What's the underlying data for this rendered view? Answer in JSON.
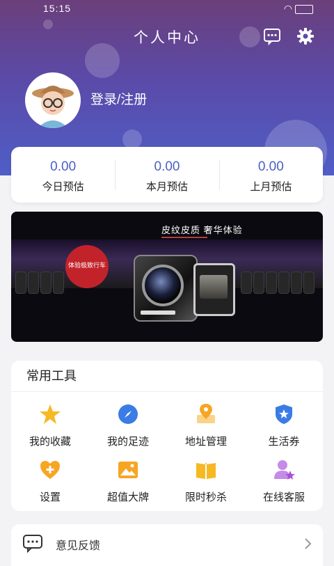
{
  "status": {
    "time": "15:15"
  },
  "header": {
    "title": "个人中心",
    "login_label": "登录/注册"
  },
  "stats": [
    {
      "value": "0.00",
      "label": "今日预估"
    },
    {
      "value": "0.00",
      "label": "本月预估"
    },
    {
      "value": "0.00",
      "label": "上月预估"
    }
  ],
  "banner": {
    "title": "皮纹皮质 奢华体验",
    "badge": "体验极致行车"
  },
  "tools": {
    "heading": "常用工具",
    "items": [
      {
        "label": "我的收藏",
        "icon": "star-icon"
      },
      {
        "label": "我的足迹",
        "icon": "compass-icon"
      },
      {
        "label": "地址管理",
        "icon": "location-pin-icon"
      },
      {
        "label": "生活券",
        "icon": "shield-star-icon"
      },
      {
        "label": "设置",
        "icon": "heart-plus-icon"
      },
      {
        "label": "超值大牌",
        "icon": "picture-icon"
      },
      {
        "label": "限时秒杀",
        "icon": "book-icon"
      },
      {
        "label": "在线客服",
        "icon": "user-star-icon"
      }
    ]
  },
  "feedback": {
    "label": "意见反馈"
  },
  "colors": {
    "accent": "#4b5fc6",
    "header_top": "#6b3f7a",
    "header_bottom": "#4f5ec7",
    "orange": "#f6a623",
    "blue": "#3b7be6",
    "purple": "#c58be8"
  }
}
